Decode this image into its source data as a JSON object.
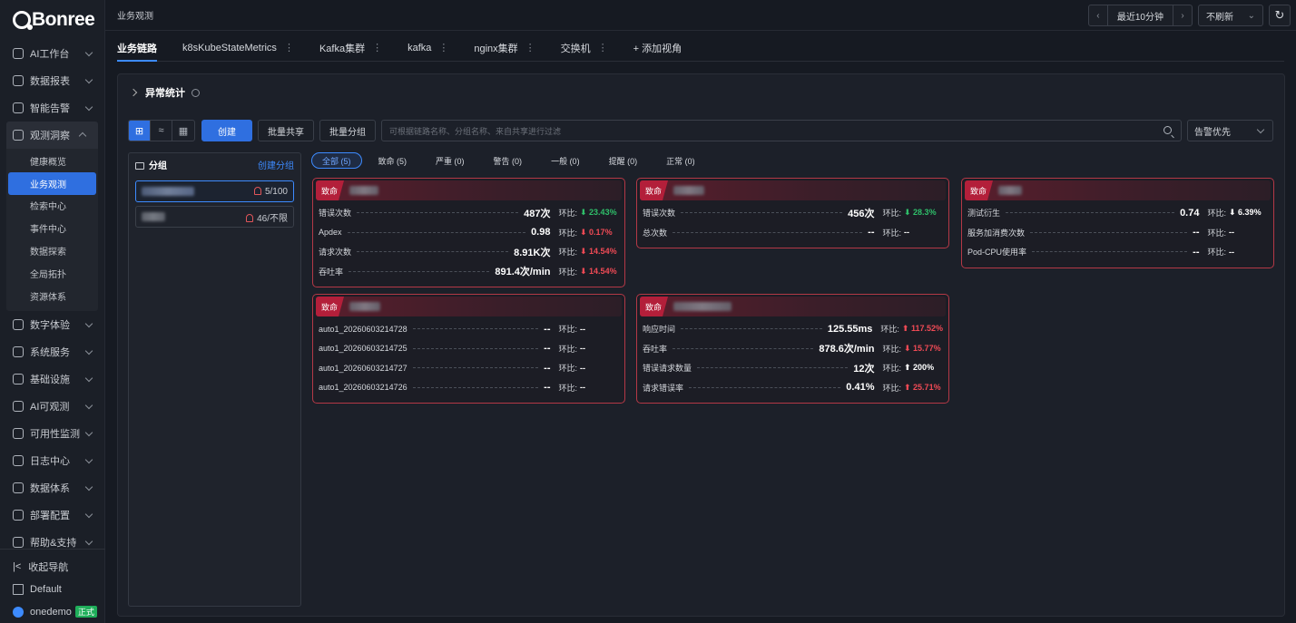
{
  "brand": {
    "name": "Bonree"
  },
  "sidebar": {
    "items": [
      {
        "label": "AI工作台"
      },
      {
        "label": "数据报表"
      },
      {
        "label": "智能告警"
      },
      {
        "label": "观测洞察"
      },
      {
        "label": "数字体验"
      },
      {
        "label": "系统服务"
      },
      {
        "label": "基础设施"
      },
      {
        "label": "AI可观测"
      },
      {
        "label": "可用性监测"
      },
      {
        "label": "日志中心"
      },
      {
        "label": "数据体系"
      },
      {
        "label": "部署配置"
      },
      {
        "label": "帮助&支持"
      }
    ],
    "sub_items": [
      {
        "label": "健康概览"
      },
      {
        "label": "业务观测"
      },
      {
        "label": "检索中心"
      },
      {
        "label": "事件中心"
      },
      {
        "label": "数据探索"
      },
      {
        "label": "全局拓扑"
      },
      {
        "label": "资源体系"
      }
    ],
    "collapse_label": "收起导航",
    "workspace": "Default",
    "user": "onedemo",
    "user_badge": "正式"
  },
  "topbar": {
    "breadcrumb": "业务观测",
    "time_range": "最近10分钟",
    "refresh": "不刷新"
  },
  "tabs": [
    {
      "label": "业务链路"
    },
    {
      "label": "k8sKubeStateMetrics"
    },
    {
      "label": "Kafka集群"
    },
    {
      "label": "kafka"
    },
    {
      "label": "nginx集群"
    },
    {
      "label": "交换机"
    },
    {
      "label": "+ 添加视角"
    }
  ],
  "panel": {
    "title": "异常统计",
    "create_btn": "创建",
    "share_btn": "批量共享",
    "group_btn": "批量分组",
    "search_placeholder": "可根据链路名称、分组名称、来自共享进行过滤",
    "sort": "告警优先"
  },
  "groups": {
    "title": "分组",
    "create_link": "创建分组",
    "items": [
      {
        "count": "5/100"
      },
      {
        "count": "46/不限"
      }
    ]
  },
  "filters": [
    {
      "label": "全部 (5)"
    },
    {
      "label": "致命 (5)"
    },
    {
      "label": "严重 (0)"
    },
    {
      "label": "警告 (0)"
    },
    {
      "label": "一般 (0)"
    },
    {
      "label": "提醒 (0)"
    },
    {
      "label": "正常 (0)"
    }
  ],
  "cards": [
    {
      "severity": "致命",
      "rows": [
        {
          "k": "错误次数",
          "v": "487次",
          "cmp": "环比:",
          "chg": "23.43%",
          "dir": "down"
        },
        {
          "k": "Apdex",
          "v": "0.98",
          "cmp": "环比:",
          "chg": "0.17%",
          "dir": "up"
        },
        {
          "k": "请求次数",
          "v": "8.91K次",
          "cmp": "环比:",
          "chg": "14.54%",
          "dir": "up"
        },
        {
          "k": "吞吐率",
          "v": "891.4次/min",
          "cmp": "环比:",
          "chg": "14.54%",
          "dir": "up"
        }
      ]
    },
    {
      "severity": "致命",
      "rows": [
        {
          "k": "错误次数",
          "v": "456次",
          "cmp": "环比:",
          "chg": "28.3%",
          "dir": "down"
        },
        {
          "k": "总次数",
          "v": "--",
          "cmp": "环比:",
          "chg": "--",
          "dir": "none"
        }
      ]
    },
    {
      "severity": "致命",
      "rows": [
        {
          "k": "测试衍生",
          "v": "0.74",
          "cmp": "环比:",
          "chg": "6.39%",
          "dir": "neu"
        },
        {
          "k": "服务加消费次数",
          "v": "--",
          "cmp": "环比:",
          "chg": "--",
          "dir": "none"
        },
        {
          "k": "Pod-CPU使用率",
          "v": "--",
          "cmp": "环比:",
          "chg": "--",
          "dir": "none"
        }
      ]
    },
    {
      "severity": "致命",
      "rows": [
        {
          "k": "auto1_20260603214728",
          "v": "--",
          "cmp": "环比:",
          "chg": "--",
          "dir": "none"
        },
        {
          "k": "auto1_20260603214725",
          "v": "--",
          "cmp": "环比:",
          "chg": "--",
          "dir": "none"
        },
        {
          "k": "auto1_20260603214727",
          "v": "--",
          "cmp": "环比:",
          "chg": "--",
          "dir": "none"
        },
        {
          "k": "auto1_20260603214726",
          "v": "--",
          "cmp": "环比:",
          "chg": "--",
          "dir": "none"
        }
      ]
    },
    {
      "severity": "致命",
      "rows": [
        {
          "k": "响应时间",
          "v": "125.55ms",
          "cmp": "环比:",
          "chg": "117.52%",
          "dir": "upred"
        },
        {
          "k": "吞吐率",
          "v": "878.6次/min",
          "cmp": "环比:",
          "chg": "15.77%",
          "dir": "up"
        },
        {
          "k": "错误请求数量",
          "v": "12次",
          "cmp": "环比:",
          "chg": "200%",
          "dir": "neuup"
        },
        {
          "k": "请求错误率",
          "v": "0.41%",
          "cmp": "环比:",
          "chg": "25.71%",
          "dir": "upred"
        }
      ]
    }
  ],
  "colors": {
    "accent": "#2f6fe0",
    "fatal": "#b31f3a",
    "rise": "#f04a55",
    "fall": "#2fbf6a"
  }
}
